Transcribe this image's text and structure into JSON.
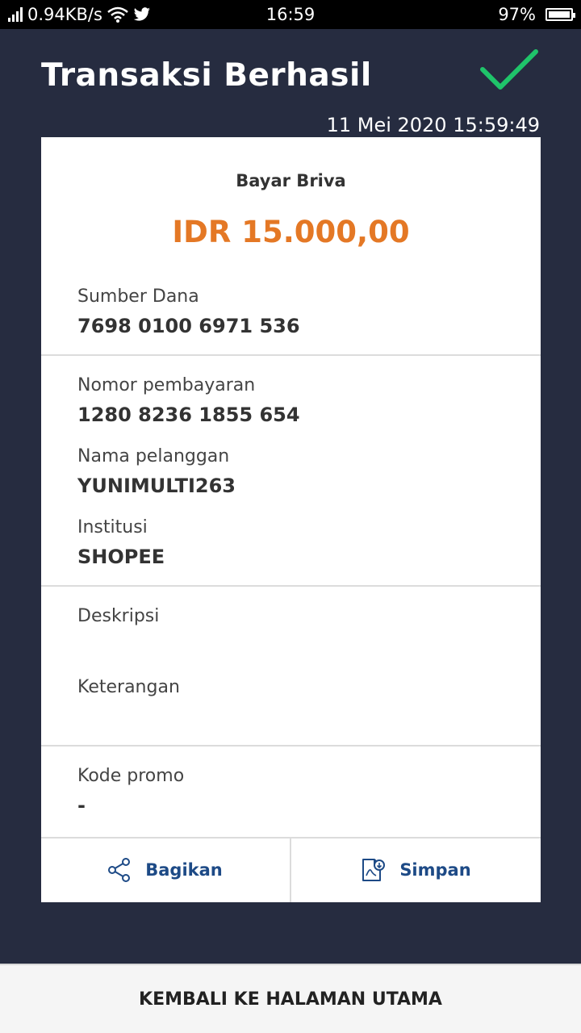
{
  "status_bar": {
    "network_speed": "0.94KB/s",
    "time": "16:59",
    "battery": "97%",
    "icons": [
      "signal-icon",
      "wifi-icon",
      "twitter-icon",
      "battery-icon"
    ]
  },
  "header": {
    "title": "Transaksi Berhasil",
    "success_icon": "checkmark-icon",
    "datetime": "11 Mei 2020 15:59:49"
  },
  "receipt": {
    "biller": "Bayar Briva",
    "amount": "IDR 15.000,00",
    "fields": [
      {
        "label": "Sumber Dana",
        "value": "7698 0100 6971 536"
      },
      {
        "label": "Nomor pembayaran",
        "value": "1280 8236 1855 654"
      },
      {
        "label": "Nama pelanggan",
        "value": "YUNIMULTI263"
      },
      {
        "label": "Institusi",
        "value": "SHOPEE"
      },
      {
        "label": "Deskripsi",
        "value": ""
      },
      {
        "label": "Keterangan",
        "value": ""
      },
      {
        "label": "Kode promo",
        "value": "-"
      }
    ]
  },
  "actions": {
    "share_label": "Bagikan",
    "save_label": "Simpan"
  },
  "footer": {
    "back_label": "KEMBALI KE HALAMAN UTAMA"
  },
  "colors": {
    "background": "#262c40",
    "amount": "#e47825",
    "success": "#1fc46a",
    "action": "#1d4a86"
  }
}
